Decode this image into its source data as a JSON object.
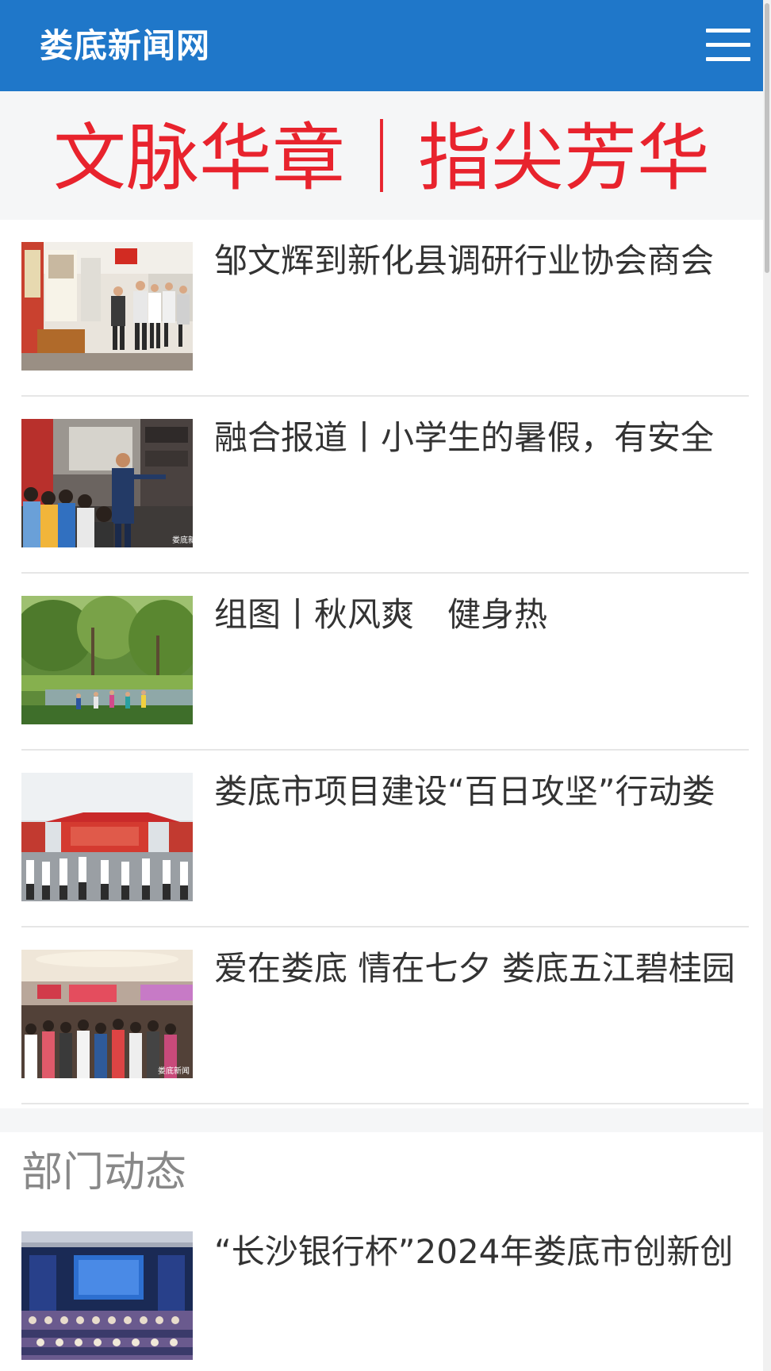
{
  "header": {
    "logo": "娄底新闻网",
    "menu_icon": "hamburger-menu-icon",
    "background": "#1f77c9"
  },
  "banner": {
    "text": "文脉华章｜指尖芳华",
    "color": "#e8232d"
  },
  "news": [
    {
      "title": "邹文辉到新化县调研行业协会商会",
      "image": "exhibition-visit-photo"
    },
    {
      "title": "融合报道丨小学生的暑假，有安全",
      "image": "fire-station-students-photo"
    },
    {
      "title": "组图丨秋风爽　健身热",
      "image": "park-exercise-photo"
    },
    {
      "title": "娄底市项目建设“百日攻坚”行动娄",
      "image": "project-ceremony-photo"
    },
    {
      "title": "爱在娄底 情在七夕 娄底五江碧桂园",
      "image": "mall-event-photo"
    }
  ],
  "departments": {
    "section_title": "部门动态",
    "items": [
      {
        "title": "“长沙银行杯”2024年娄底市创新创",
        "image": "conference-hall-photo"
      }
    ]
  }
}
